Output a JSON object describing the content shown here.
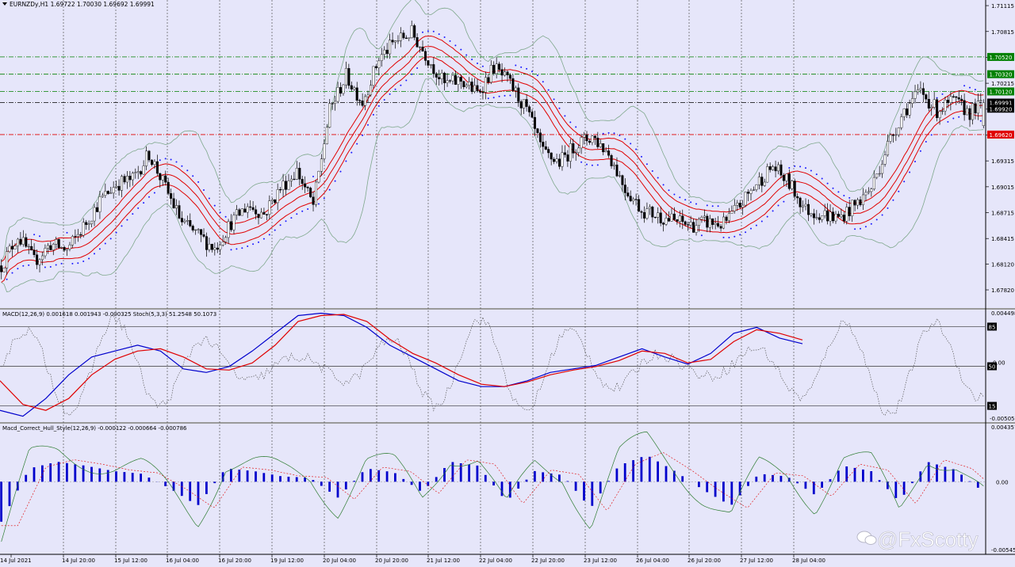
{
  "chart_data": [
    {
      "type": "candlestick",
      "symbol_header": "EURNZDy,H1  1.69722 1.70030 1.69692 1.69991",
      "ylim": [
        1.676,
        1.7118
      ],
      "y_ticks": [
        "1.71115",
        "1.70815",
        "1.70515",
        "1.70215",
        "1.69915",
        "1.69615",
        "1.69315",
        "1.69015",
        "1.68715",
        "1.68415",
        "1.68120",
        "1.67820"
      ],
      "price_levels": [
        {
          "price": 1.7052,
          "label": "1.70520",
          "color": "#008000",
          "style": "dashdot"
        },
        {
          "price": 1.7032,
          "label": "1.70320",
          "color": "#008000",
          "style": "dashdot"
        },
        {
          "price": 1.7012,
          "label": "1.70120",
          "color": "#008000",
          "style": "dashdot"
        },
        {
          "price": 1.69991,
          "label": "1.69991",
          "color": "#000000",
          "style": "dashdot"
        },
        {
          "price": 1.6992,
          "label": "1.69920",
          "color": "#000000",
          "style": "none"
        },
        {
          "price": 1.6962,
          "label": "1.69620",
          "color": "#e00000",
          "style": "dashdot"
        }
      ],
      "close_profile": [
        [
          0,
          1.681
        ],
        [
          6,
          1.6845
        ],
        [
          12,
          1.6815
        ],
        [
          18,
          1.6835
        ],
        [
          24,
          1.6828
        ],
        [
          30,
          1.6855
        ],
        [
          36,
          1.6885
        ],
        [
          42,
          1.6905
        ],
        [
          48,
          1.691
        ],
        [
          54,
          1.694
        ],
        [
          60,
          1.69
        ],
        [
          66,
          1.686
        ],
        [
          72,
          1.6845
        ],
        [
          78,
          1.683
        ],
        [
          84,
          1.686
        ],
        [
          90,
          1.688
        ],
        [
          96,
          1.687
        ],
        [
          102,
          1.69
        ],
        [
          108,
          1.692
        ],
        [
          114,
          1.688
        ],
        [
          120,
          1.699
        ],
        [
          126,
          1.703
        ],
        [
          132,
          1.7
        ],
        [
          138,
          1.705
        ],
        [
          144,
          1.707
        ],
        [
          150,
          1.708
        ],
        [
          156,
          1.705
        ],
        [
          162,
          1.702
        ],
        [
          168,
          1.7025
        ],
        [
          174,
          1.701
        ],
        [
          180,
          1.704
        ],
        [
          186,
          1.702
        ],
        [
          192,
          1.699
        ],
        [
          198,
          1.694
        ],
        [
          204,
          1.693
        ],
        [
          210,
          1.695
        ],
        [
          216,
          1.696
        ],
        [
          222,
          1.694
        ],
        [
          228,
          1.69
        ],
        [
          234,
          1.6875
        ],
        [
          240,
          1.6868
        ],
        [
          246,
          1.6862
        ],
        [
          252,
          1.6857
        ],
        [
          258,
          1.686
        ],
        [
          264,
          1.6858
        ],
        [
          270,
          1.688
        ],
        [
          276,
          1.6905
        ],
        [
          282,
          1.6925
        ],
        [
          288,
          1.6905
        ],
        [
          294,
          1.6875
        ],
        [
          300,
          1.687
        ],
        [
          306,
          1.6865
        ],
        [
          312,
          1.688
        ],
        [
          318,
          1.69
        ],
        [
          324,
          1.695
        ],
        [
          330,
          1.699
        ],
        [
          336,
          1.7012
        ],
        [
          342,
          1.699
        ],
        [
          348,
          1.7
        ],
        [
          354,
          1.6988
        ],
        [
          360,
          1.6999
        ]
      ],
      "indicators": [
        "Bollinger Bands (gray)",
        "Envelope / MA channel (red)",
        "Parabolic SAR (blue dots)"
      ]
    },
    {
      "type": "line",
      "header": "MACD(12,26,9) 0.001618 0.001943 -0.000325  Stoch(5,3,3) 51.2548 50.1073",
      "ylim": [
        -0.005058,
        0.004498
      ],
      "y_ticks": [
        "0.004498",
        "-0.005058"
      ],
      "level_labels": [
        "85",
        "50",
        "15"
      ],
      "zero_label": "0.00",
      "series": [
        {
          "color": "#0000cc",
          "values": [
            -0.004,
            -0.0045,
            -0.003,
            -0.001,
            0.0005,
            0.001,
            0.0015,
            0.001,
            -0.0005,
            -0.0008,
            -0.0003,
            0.001,
            0.0025,
            0.004,
            0.0042,
            0.004,
            0.003,
            0.0015,
            0.0005,
            -0.0005,
            -0.0015,
            -0.002,
            -0.002,
            -0.0015,
            -0.0008,
            -0.0005,
            -0.0002,
            0.0005,
            0.0012,
            0.0005,
            -0.0001,
            0.0008,
            0.0025,
            0.003,
            0.0021,
            0.00162
          ]
        },
        {
          "color": "#e00000",
          "values": [
            -0.0015,
            -0.0035,
            -0.004,
            -0.003,
            -0.001,
            0.0003,
            0.001,
            0.0012,
            0.0005,
            -0.0005,
            -0.0006,
            0.0,
            0.0015,
            0.0035,
            0.004,
            0.0041,
            0.0035,
            0.002,
            0.0008,
            0.0,
            -0.001,
            -0.0018,
            -0.002,
            -0.0016,
            -0.001,
            -0.0006,
            -0.0003,
            0.0002,
            0.001,
            0.0008,
            0.0,
            0.0003,
            0.0018,
            0.0028,
            0.0025,
            0.00194
          ]
        }
      ]
    },
    {
      "type": "histogram",
      "header": "Macd_Correct_Hull_Style(12,26,9) -0.000122 -0.000664 -0.000786",
      "ylim": [
        -0.00545,
        0.004357
      ],
      "y_ticks": [
        "0.004357",
        "0.00",
        "-0.00545"
      ],
      "values": [
        -0.003,
        0.001,
        0.0015,
        0.0012,
        0.0008,
        0.0006,
        -0.0005,
        -0.0018,
        0.001,
        0.0008,
        0.0004,
        0.0003,
        -0.0012,
        0.001,
        0.0007,
        -0.0008,
        0.0015,
        0.0012,
        -0.0015,
        0.0008,
        0.0005,
        -0.002,
        0.0012,
        0.002,
        0.0008,
        -0.0006,
        -0.0018,
        0.0006,
        0.0004,
        -0.001,
        0.0012,
        0.0008,
        -0.0015,
        0.0015,
        0.0009,
        -0.00078
      ]
    }
  ],
  "x_labels": [
    "14 Jul 2021",
    "14 Jul 20:00",
    "15 Jul 12:00",
    "16 Jul 04:00",
    "16 Jul 20:00",
    "19 Jul 12:00",
    "20 Jul 04:00",
    "20 Jul 20:00",
    "21 Jul 12:00",
    "22 Jul 04:00",
    "22 Jul 20:00",
    "23 Jul 12:00",
    "26 Jul 04:00",
    "26 Jul 20:00",
    "27 Jul 12:00",
    "28 Jul 04:00"
  ],
  "colors": {
    "background": "#e6e6fa",
    "bull": "#ffffff",
    "bear": "#000000",
    "bands": "#7fa88c",
    "channel": "#e00000",
    "sar": "#1a1aff",
    "macd": "#0000cc",
    "signal": "#e00000",
    "stoch": "#5a5a5a",
    "hist": "#0000cc"
  },
  "watermark": "@FxScotty"
}
